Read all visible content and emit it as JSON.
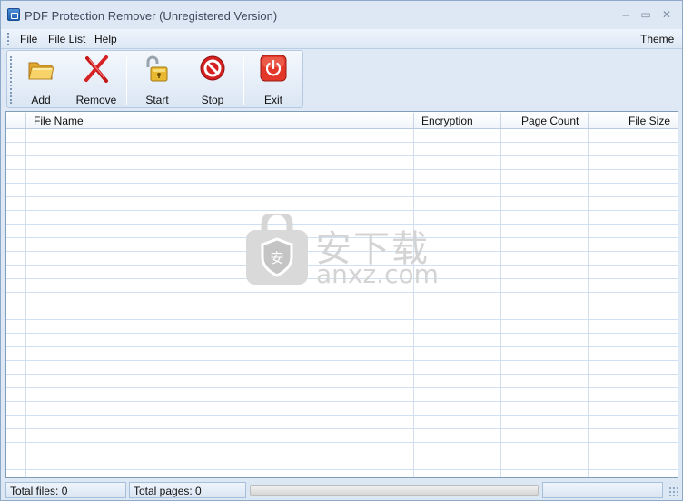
{
  "window": {
    "title": "PDF Protection Remover (Unregistered Version)",
    "controls": {
      "minimize": "–",
      "maximize": "▭",
      "close": "✕"
    }
  },
  "menu": {
    "file": "File",
    "file_list": "File List",
    "help": "Help",
    "theme": "Theme"
  },
  "toolbar": {
    "add": {
      "label": "Add",
      "icon": "folder-icon"
    },
    "remove": {
      "label": "Remove",
      "icon": "red-x-icon"
    },
    "start": {
      "label": "Start",
      "icon": "unlock-padlock-icon"
    },
    "stop": {
      "label": "Stop",
      "icon": "stop-sign-icon"
    },
    "exit": {
      "label": "Exit",
      "icon": "power-icon"
    }
  },
  "file_list": {
    "columns": [
      "File Name",
      "Encryption",
      "Page Count",
      "File Size"
    ],
    "rows": []
  },
  "watermark": {
    "text_cn": "安下载",
    "text_en": "anxz.com",
    "shield_char": "安"
  },
  "status": {
    "total_files": "Total files: 0",
    "total_pages": "Total pages: 0",
    "progress": 0
  },
  "colors": {
    "accent": "#1d5fb5",
    "frame": "#dfe9f5",
    "grid": "#cfe0f2",
    "stop_red": "#d42020",
    "exit_red": "#e3372a"
  }
}
